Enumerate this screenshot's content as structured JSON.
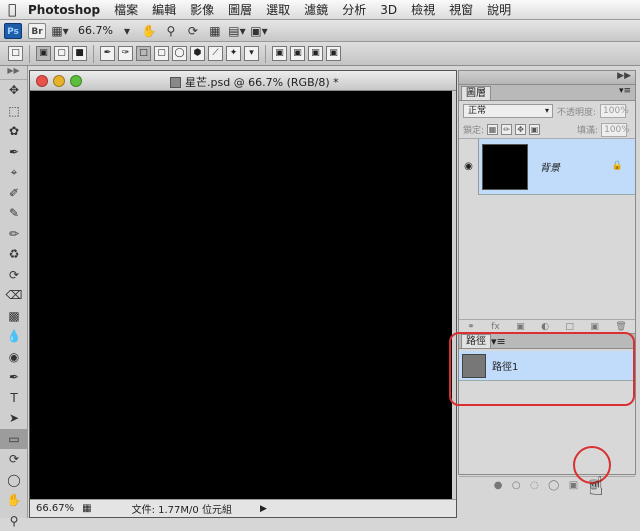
{
  "menubar": {
    "app": "Photoshop",
    "items": [
      "檔案",
      "編輯",
      "影像",
      "圖層",
      "選取",
      "濾鏡",
      "分析",
      "3D",
      "檢視",
      "視窗",
      "說明"
    ]
  },
  "appbar": {
    "ps_label": "Ps",
    "br_label": "Br",
    "zoom": "66.7%"
  },
  "document": {
    "title": "星芒.psd @ 66.7% (RGB/8) *",
    "zoom_status": "66.67%",
    "doc_size": "文件: 1.77M/0 位元組"
  },
  "layers_panel": {
    "tab": "圖層",
    "blend_mode": "正常",
    "opacity_label": "不透明度:",
    "opacity_value": "100%",
    "lock_label": "鎖定:",
    "fill_label": "填滿:",
    "fill_value": "100%",
    "layer_name": "背景"
  },
  "paths_panel": {
    "tab": "路徑",
    "path_name": "路徑1"
  },
  "colors": {
    "highlight": "#d93030",
    "selection": "#c1dcfb"
  }
}
